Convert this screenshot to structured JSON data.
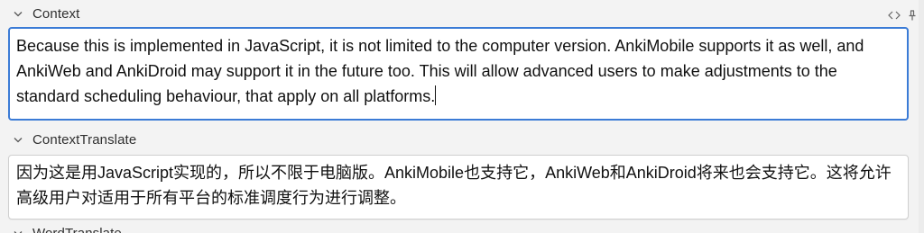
{
  "fields": [
    {
      "label": "Context",
      "text": "Because this is implemented in JavaScript, it is not limited to the computer version. AnkiMobile supports it as well, and AnkiWeb and AnkiDroid may support it in the future too. This will allow advanced users to make adjustments to the standard scheduling behaviour, that apply on all platforms."
    },
    {
      "label": "ContextTranslate",
      "text": "因为这是用JavaScript实现的，所以不限于电脑版。AnkiMobile也支持它，AnkiWeb和AnkiDroid将来也会支持它。这将允许高级用户对适用于所有平台的标准调度行为进行调整。"
    },
    {
      "label": "WordTranslate"
    }
  ],
  "icons": {
    "collapse": "chevron-down-icon",
    "html_editor": "code-brackets-icon",
    "sticky": "pin-icon"
  },
  "colors": {
    "focus_border": "#3b7bd6",
    "background": "#f3f3f3",
    "editor_bg": "#ffffff"
  }
}
